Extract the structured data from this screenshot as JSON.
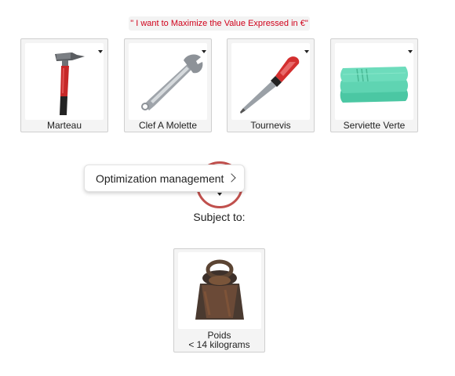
{
  "objective": {
    "text": "\" I want to Maximize the Value Expressed in €\""
  },
  "items": [
    {
      "label": "Marteau",
      "icon": "hammer-icon"
    },
    {
      "label": "Clef A Molette",
      "icon": "adjustable-wrench-icon"
    },
    {
      "label": "Tournevis",
      "icon": "screwdriver-icon"
    },
    {
      "label": "Serviette Verte",
      "icon": "green-towel-icon"
    }
  ],
  "optimization": {
    "menu_label": "Optimization management"
  },
  "subject_to": "Subject to:",
  "constraint": {
    "name": "Poids",
    "limit": "< 14 kilograms",
    "icon": "cast-iron-weight-icon"
  },
  "colors": {
    "objective_text": "#d0021b",
    "optimization_ring": "#c0504d"
  }
}
